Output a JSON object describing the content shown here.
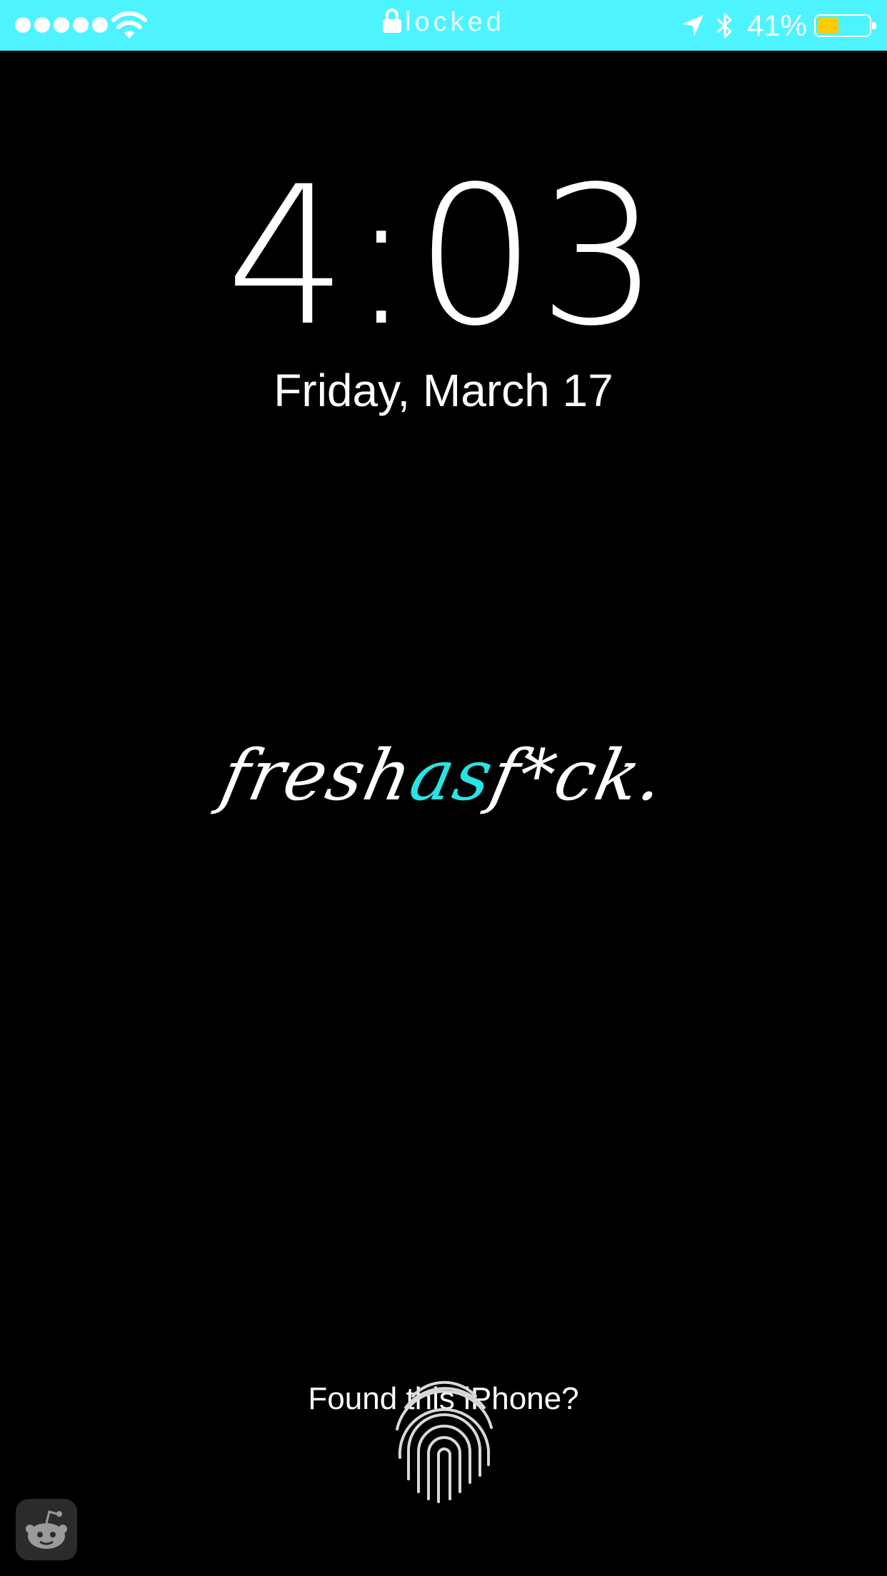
{
  "status_bar": {
    "background_color": "#4df4ff",
    "signal_bars": 5,
    "lock_label": "locked",
    "battery_percent_label": "41%",
    "battery_level": 0.41,
    "battery_fill_color": "#ffcc00",
    "icons": [
      "wifi-icon",
      "lock-icon",
      "location-arrow-icon",
      "bluetooth-icon",
      "battery-icon"
    ]
  },
  "lock_screen": {
    "time": "4:03",
    "date": "Friday, March 17"
  },
  "wallpaper": {
    "logo_part1": "fresh",
    "logo_accent": "as",
    "logo_part2": "f*ck.",
    "accent_color": "#27e4e6"
  },
  "bottom": {
    "found_text": "Found this iPhone?",
    "icons": [
      "fingerprint-icon",
      "reddit-alien-icon"
    ]
  }
}
